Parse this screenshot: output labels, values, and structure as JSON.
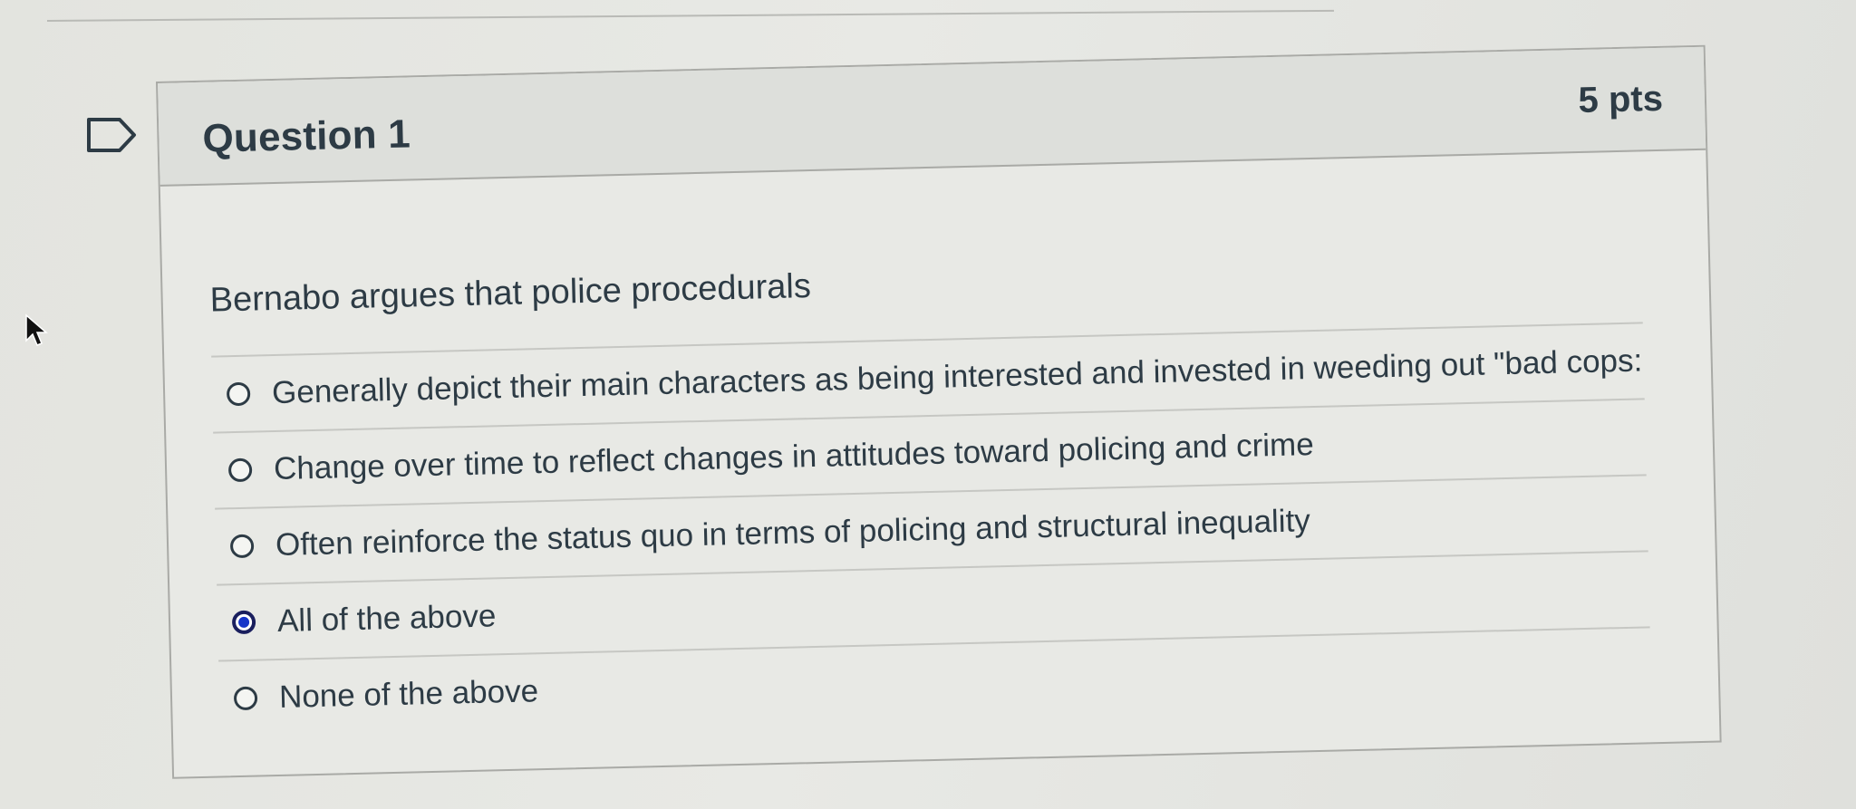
{
  "question": {
    "title": "Question 1",
    "points": "5 pts",
    "prompt": "Bernabo argues that police procedurals",
    "answers": [
      {
        "label": "Generally depict their main characters as being interested and invested in weeding out \"bad cops:",
        "selected": false
      },
      {
        "label": "Change over time to reflect changes in attitudes toward policing and crime",
        "selected": false
      },
      {
        "label": "Often reinforce the status quo in terms of policing and structural inequality",
        "selected": false
      },
      {
        "label": "All of the above",
        "selected": true
      },
      {
        "label": "None of the above",
        "selected": false
      }
    ]
  },
  "colors": {
    "text": "#2d3b45",
    "selected_radio": "#1635c9",
    "border": "#a9aaa6"
  }
}
